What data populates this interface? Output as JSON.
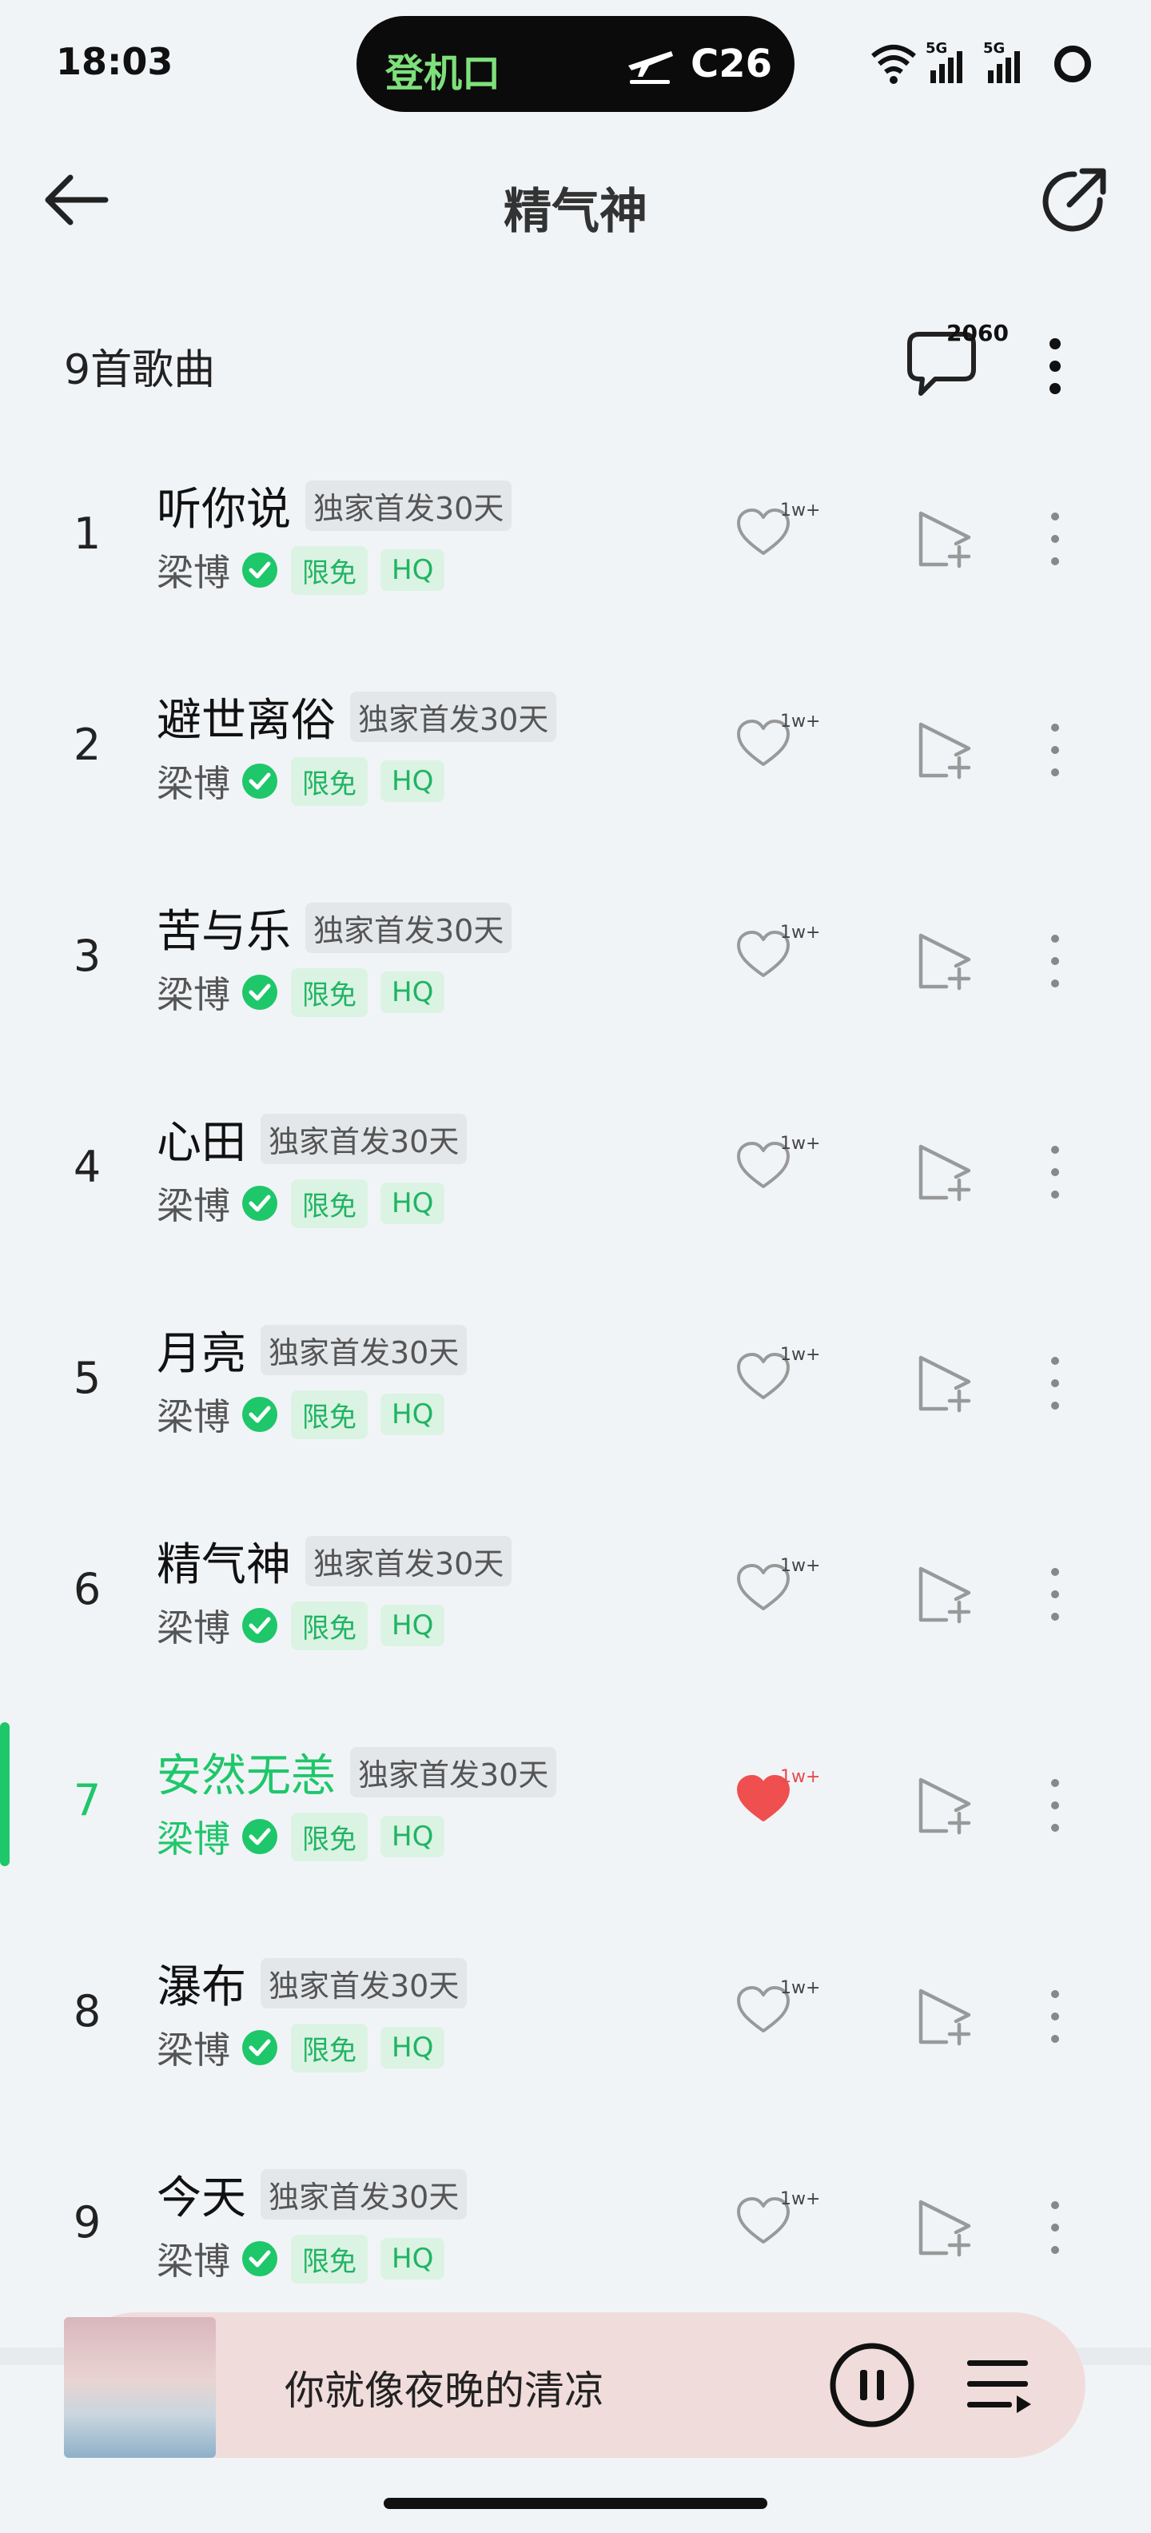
{
  "status_bar": {
    "time": "18:03",
    "pill_left": "登机口",
    "pill_right": "C26",
    "icons": [
      "wifi-icon",
      "5g-signal-icon",
      "5g-signal-icon",
      "battery-ring-icon"
    ]
  },
  "header": {
    "title": "精气神",
    "back_icon": "arrow-left-icon",
    "share_icon": "share-arrow-icon"
  },
  "list_header": {
    "song_count": "9首歌曲",
    "comment_count": "2060"
  },
  "songs": [
    {
      "num": "1",
      "title": "听你说",
      "tag": "独家首发30天",
      "artist": "梁博",
      "free": "限免",
      "hq": "HQ",
      "likes": "1w+",
      "liked": false
    },
    {
      "num": "2",
      "title": "避世离俗",
      "tag": "独家首发30天",
      "artist": "梁博",
      "free": "限免",
      "hq": "HQ",
      "likes": "1w+",
      "liked": false
    },
    {
      "num": "3",
      "title": "苦与乐",
      "tag": "独家首发30天",
      "artist": "梁博",
      "free": "限免",
      "hq": "HQ",
      "likes": "1w+",
      "liked": false
    },
    {
      "num": "4",
      "title": "心田",
      "tag": "独家首发30天",
      "artist": "梁博",
      "free": "限免",
      "hq": "HQ",
      "likes": "1w+",
      "liked": false
    },
    {
      "num": "5",
      "title": "月亮",
      "tag": "独家首发30天",
      "artist": "梁博",
      "free": "限免",
      "hq": "HQ",
      "likes": "1w+",
      "liked": false
    },
    {
      "num": "6",
      "title": "精气神",
      "tag": "独家首发30天",
      "artist": "梁博",
      "free": "限免",
      "hq": "HQ",
      "likes": "1w+",
      "liked": false
    },
    {
      "num": "7",
      "title": "安然无恙",
      "tag": "独家首发30天",
      "artist": "梁博",
      "free": "限免",
      "hq": "HQ",
      "likes": "1w+",
      "liked": true
    },
    {
      "num": "8",
      "title": "瀑布",
      "tag": "独家首发30天",
      "artist": "梁博",
      "free": "限免",
      "hq": "HQ",
      "likes": "1w+",
      "liked": false
    },
    {
      "num": "9",
      "title": "今天",
      "tag": "独家首发30天",
      "artist": "梁博",
      "free": "限免",
      "hq": "HQ",
      "likes": "1w+",
      "liked": false
    }
  ],
  "active_song_index": 6,
  "player": {
    "now_playing": "你就像夜晚的清凉",
    "state": "playing"
  },
  "colors": {
    "accent": "#1ec76a",
    "liked_heart": "#ef4f4f",
    "tag_green_bg": "#dbf3e3",
    "player_bg": "#f1dcdc"
  }
}
